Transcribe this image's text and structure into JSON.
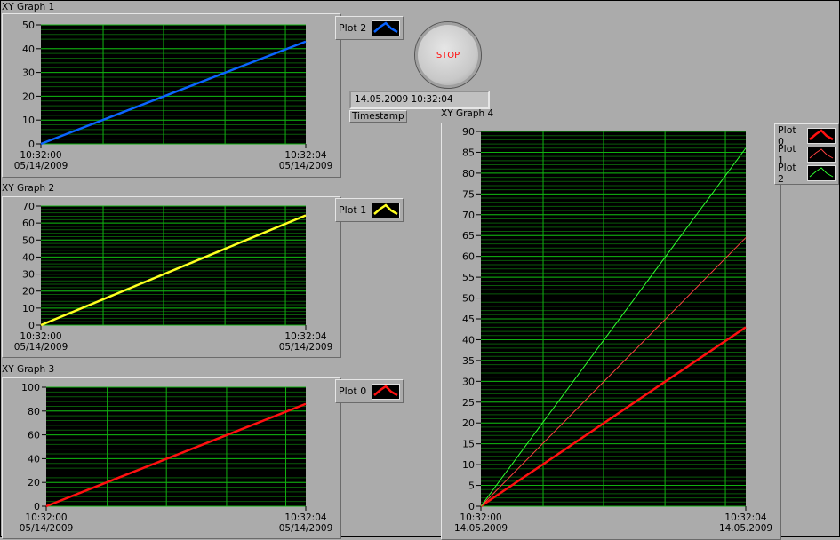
{
  "graphs": [
    {
      "title": "XY Graph 1",
      "legend": [
        {
          "name": "Plot 2",
          "color": "#0a64ff",
          "thick": true
        }
      ]
    },
    {
      "title": "XY Graph 2",
      "legend": [
        {
          "name": "Plot 1",
          "color": "#ffff20",
          "thick": true
        }
      ]
    },
    {
      "title": "XY Graph 3",
      "legend": [
        {
          "name": "Plot 0",
          "color": "#ff1010",
          "thick": true
        }
      ]
    },
    {
      "title": "XY Graph 4",
      "legend": [
        {
          "name": "Plot 0",
          "color": "#ff1010",
          "thick": true
        },
        {
          "name": "Plot 1",
          "color": "#ff4040",
          "thick": false
        },
        {
          "name": "Plot 2",
          "color": "#30ff30",
          "thick": false
        }
      ]
    }
  ],
  "stop_label": "STOP",
  "timestamp": {
    "value": "14.05.2009 10:32:04",
    "label": "Timestamp"
  },
  "chart_data": [
    {
      "type": "line",
      "title": "XY Graph 1",
      "xlabels": [
        [
          "10:32:00",
          "05/14/2009"
        ],
        [
          "10:32:04",
          "05/14/2009"
        ]
      ],
      "xlim": [
        0,
        4
      ],
      "ylim": [
        0,
        50
      ],
      "yticks": [
        0,
        10,
        20,
        30,
        40,
        50
      ],
      "series": [
        {
          "name": "Plot 2",
          "x": [
            0,
            4
          ],
          "y": [
            0,
            43
          ]
        }
      ]
    },
    {
      "type": "line",
      "title": "XY Graph 2",
      "xlabels": [
        [
          "10:32:00",
          "05/14/2009"
        ],
        [
          "10:32:04",
          "05/14/2009"
        ]
      ],
      "xlim": [
        0,
        4
      ],
      "ylim": [
        0,
        70
      ],
      "yticks": [
        0,
        10,
        20,
        30,
        40,
        50,
        60,
        70
      ],
      "series": [
        {
          "name": "Plot 1",
          "x": [
            0,
            4
          ],
          "y": [
            0,
            64.5
          ]
        }
      ]
    },
    {
      "type": "line",
      "title": "XY Graph 3",
      "xlabels": [
        [
          "10:32:00",
          "05/14/2009"
        ],
        [
          "10:32:04",
          "05/14/2009"
        ]
      ],
      "xlim": [
        0,
        4
      ],
      "ylim": [
        0,
        100
      ],
      "yticks": [
        0,
        20,
        40,
        60,
        80,
        100
      ],
      "series": [
        {
          "name": "Plot 0",
          "x": [
            0,
            4
          ],
          "y": [
            0,
            86
          ]
        }
      ]
    },
    {
      "type": "line",
      "title": "XY Graph 4",
      "xlabels": [
        [
          "10:32:00",
          "14.05.2009"
        ],
        [
          "10:32:04",
          "14.05.2009"
        ]
      ],
      "xlim": [
        0,
        4
      ],
      "ylim": [
        0,
        90
      ],
      "yticks": [
        0,
        5,
        10,
        15,
        20,
        25,
        30,
        35,
        40,
        45,
        50,
        55,
        60,
        65,
        70,
        75,
        80,
        85,
        90
      ],
      "series": [
        {
          "name": "Plot 0",
          "x": [
            0,
            4
          ],
          "y": [
            0,
            43
          ]
        },
        {
          "name": "Plot 1",
          "x": [
            0,
            4
          ],
          "y": [
            0,
            64.5
          ]
        },
        {
          "name": "Plot 2",
          "x": [
            0,
            4
          ],
          "y": [
            0,
            86
          ]
        }
      ]
    }
  ]
}
